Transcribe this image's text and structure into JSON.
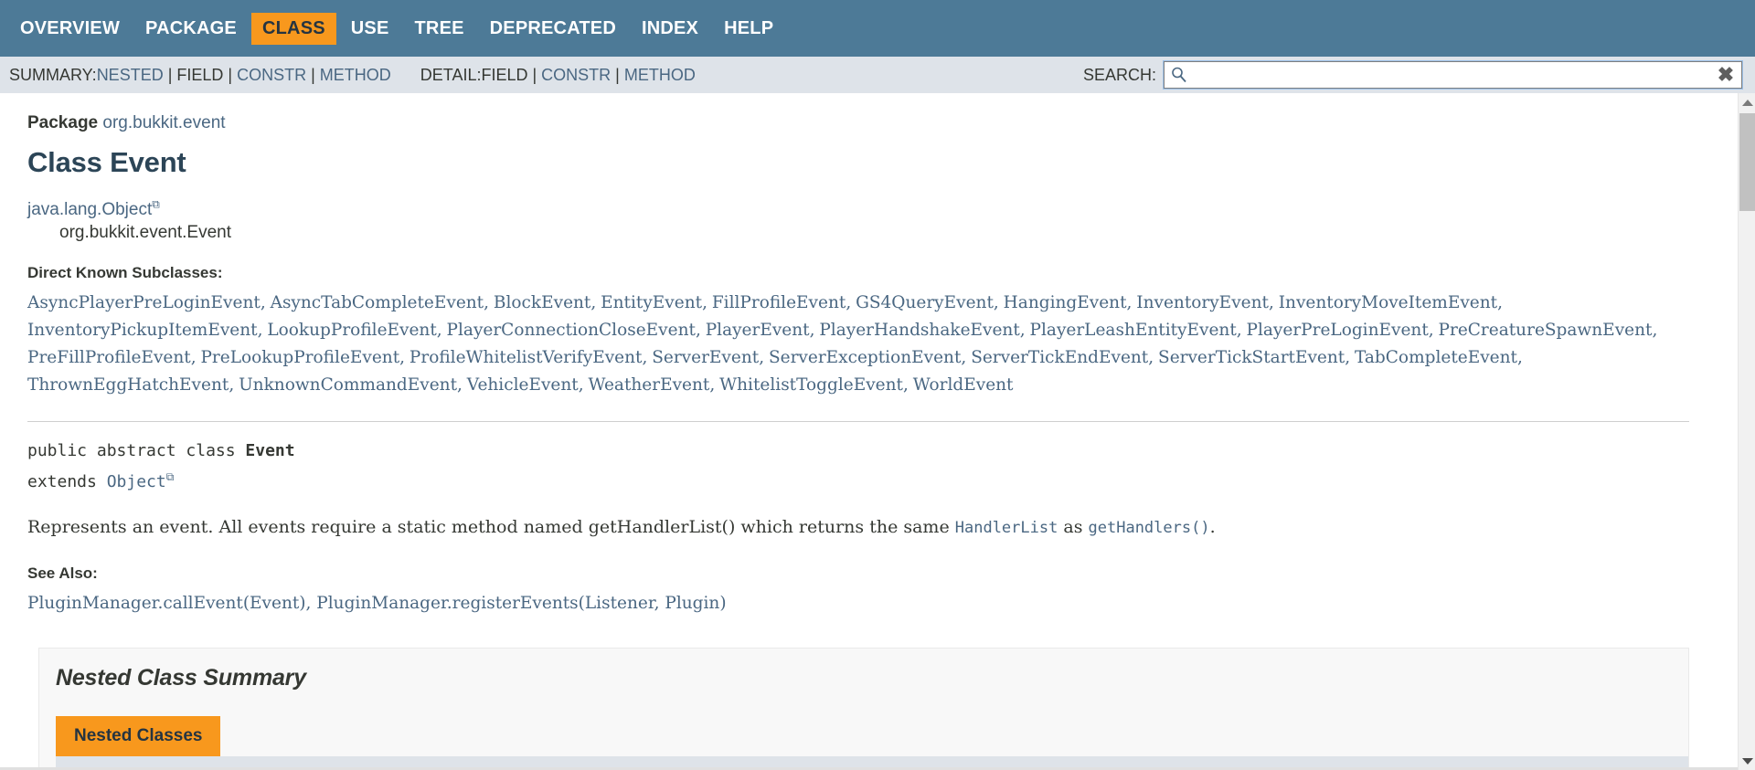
{
  "topnav": {
    "items": [
      {
        "label": "OVERVIEW",
        "active": false
      },
      {
        "label": "PACKAGE",
        "active": false
      },
      {
        "label": "CLASS",
        "active": true
      },
      {
        "label": "USE",
        "active": false
      },
      {
        "label": "TREE",
        "active": false
      },
      {
        "label": "DEPRECATED",
        "active": false
      },
      {
        "label": "INDEX",
        "active": false
      },
      {
        "label": "HELP",
        "active": false
      }
    ]
  },
  "subnav": {
    "summary_label": "SUMMARY:",
    "summary_items": [
      {
        "label": "NESTED",
        "link": true
      },
      {
        "label": "FIELD",
        "link": false
      },
      {
        "label": "CONSTR",
        "link": true
      },
      {
        "label": "METHOD",
        "link": true
      }
    ],
    "detail_label": "DETAIL:",
    "detail_items": [
      {
        "label": "FIELD",
        "link": false
      },
      {
        "label": "CONSTR",
        "link": true
      },
      {
        "label": "METHOD",
        "link": true
      }
    ],
    "separator": "|"
  },
  "search": {
    "label": "SEARCH:",
    "value": "",
    "placeholder": "",
    "icon": "search-icon",
    "reset_icon": "close-icon",
    "reset_glyph": "✖"
  },
  "header": {
    "package_label": "Package",
    "package_name": "org.bukkit.event",
    "title": "Class Event"
  },
  "inheritance": {
    "root": "java.lang.Object",
    "root_external_marker": "⧉",
    "leaf": "org.bukkit.event.Event"
  },
  "subclasses": {
    "label": "Direct Known Subclasses:",
    "items": [
      "AsyncPlayerPreLoginEvent",
      "AsyncTabCompleteEvent",
      "BlockEvent",
      "EntityEvent",
      "FillProfileEvent",
      "GS4QueryEvent",
      "HangingEvent",
      "InventoryEvent",
      "InventoryMoveItemEvent",
      "InventoryPickupItemEvent",
      "LookupProfileEvent",
      "PlayerConnectionCloseEvent",
      "PlayerEvent",
      "PlayerHandshakeEvent",
      "PlayerLeashEntityEvent",
      "PlayerPreLoginEvent",
      "PreCreatureSpawnEvent",
      "PreFillProfileEvent",
      "PreLookupProfileEvent",
      "ProfileWhitelistVerifyEvent",
      "ServerEvent",
      "ServerExceptionEvent",
      "ServerTickEndEvent",
      "ServerTickStartEvent",
      "TabCompleteEvent",
      "ThrownEggHatchEvent",
      "UnknownCommandEvent",
      "VehicleEvent",
      "WeatherEvent",
      "WhitelistToggleEvent",
      "WorldEvent"
    ]
  },
  "declaration": {
    "modifiers": "public abstract class ",
    "name": "Event",
    "extends_keyword": "extends ",
    "extends_type": "Object",
    "extends_external_marker": "⧉"
  },
  "description": {
    "part1": "Represents an event. All events require a static method named getHandlerList() which returns the same ",
    "link1": "HandlerList",
    "part2": " as ",
    "link2": "getHandlers()",
    "part3": "."
  },
  "see_also": {
    "label": "See Also:",
    "entries": [
      {
        "owner": "PluginManager.",
        "member": "callEvent(Event)"
      },
      {
        "owner": "PluginManager.",
        "member": "registerEvents(Listener, Plugin)"
      }
    ],
    "separator": ", "
  },
  "nested_summary": {
    "heading": "Nested Class Summary",
    "tabs": [
      {
        "label": "Nested Classes",
        "active": true
      }
    ]
  },
  "colors": {
    "nav_background": "#4D7A97",
    "accent_orange": "#F8981D",
    "subnav_background": "#dee3e9",
    "link_blue": "#4A6782",
    "title_blue": "#2c4557",
    "body_text": "#353833",
    "panel_background": "#f8f8f8"
  },
  "scrollbar": {
    "up_arrow": "scroll-up-arrow",
    "down_arrow": "scroll-down-arrow"
  }
}
